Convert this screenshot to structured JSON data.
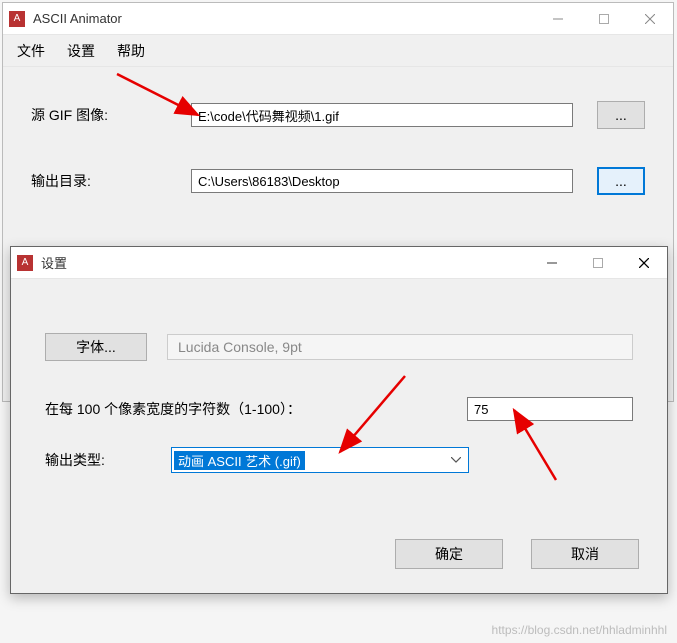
{
  "main": {
    "title": "ASCII Animator",
    "menus": {
      "file": "文件",
      "settings": "设置",
      "help": "帮助"
    },
    "source_label": "源 GIF 图像:",
    "source_value": "E:\\code\\代码舞视频\\1.gif",
    "output_label": "输出目录:",
    "output_value": "C:\\Users\\86183\\Desktop",
    "browse": "..."
  },
  "dialog": {
    "title": "设置",
    "font_btn": "字体...",
    "font_display": "Lucida Console, 9pt",
    "chars_label": "在每 100 个像素宽度的字符数（1-100）：",
    "chars_value": "75",
    "output_type_label": "输出类型:",
    "output_type_selected": "动画 ASCII 艺术 (.gif)",
    "ok": "确定",
    "cancel": "取消"
  },
  "watermark": "https://blog.csdn.net/hhladminhhl"
}
